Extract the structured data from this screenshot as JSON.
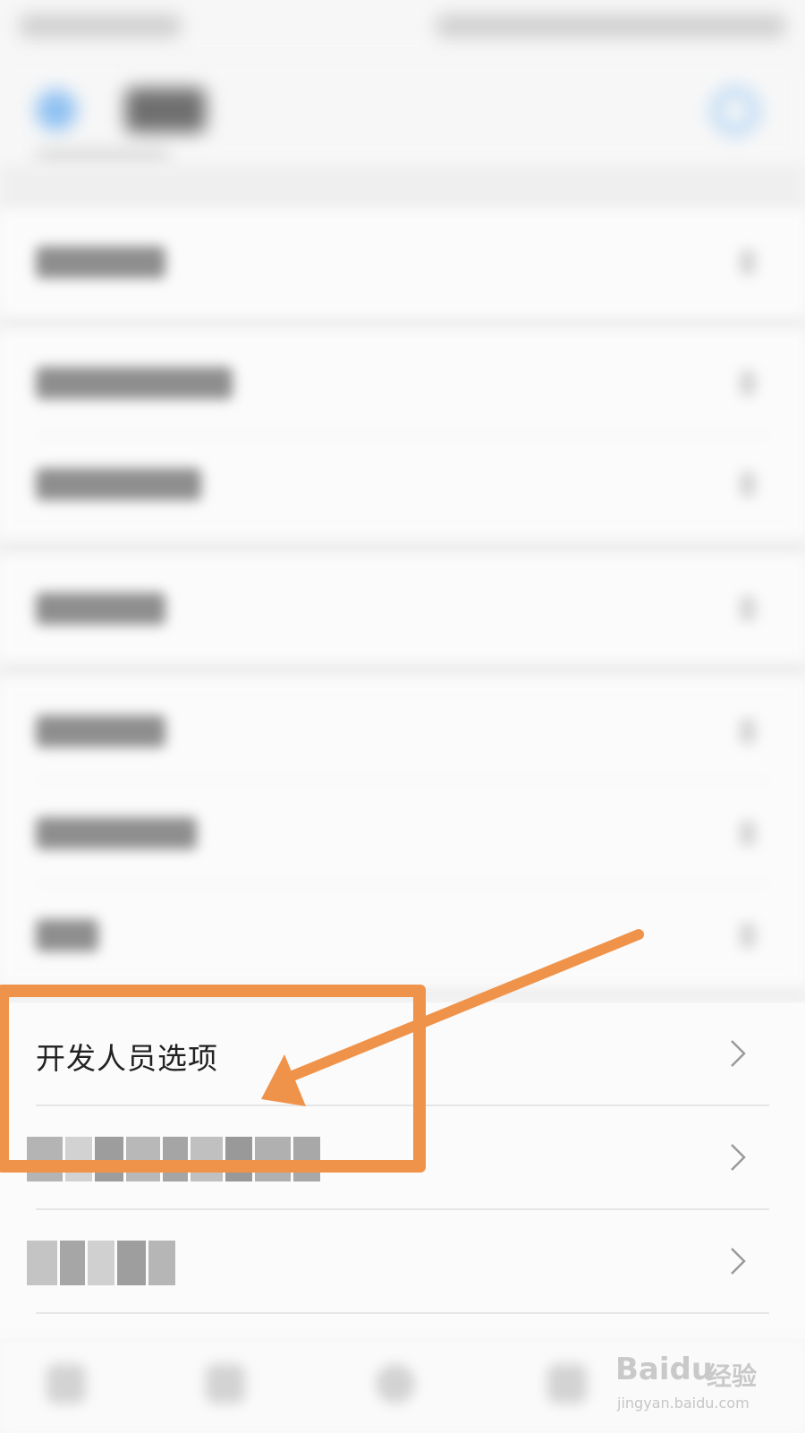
{
  "developer_options": {
    "label": "开发人员选项"
  },
  "colors": {
    "highlight": "#f0934a",
    "accent_blue": "#8fc1f2"
  },
  "watermark": {
    "logo": "Baidu",
    "brand": "经验",
    "url": "jingyan.baidu.com"
  }
}
